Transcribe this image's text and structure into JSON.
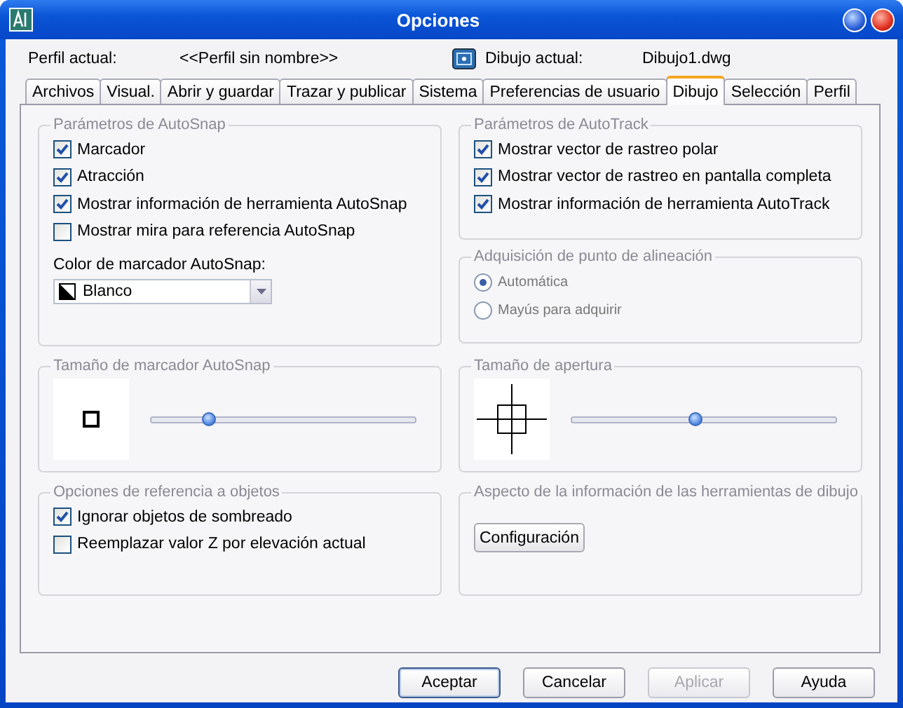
{
  "window": {
    "title": "Opciones"
  },
  "profile": {
    "label": "Perfil actual:",
    "value": "<<Perfil sin nombre>>"
  },
  "drawing": {
    "label": "Dibujo actual:",
    "value": "Dibujo1.dwg"
  },
  "tabs": [
    {
      "label": "Archivos",
      "selected": false
    },
    {
      "label": "Visual.",
      "selected": false
    },
    {
      "label": "Abrir y guardar",
      "selected": false
    },
    {
      "label": "Trazar y publicar",
      "selected": false
    },
    {
      "label": "Sistema",
      "selected": false
    },
    {
      "label": "Preferencias de usuario",
      "selected": false
    },
    {
      "label": "Dibujo",
      "selected": true
    },
    {
      "label": "Selección",
      "selected": false
    },
    {
      "label": "Perfil",
      "selected": false
    }
  ],
  "autosnap": {
    "title": "Parámetros de AutoSnap",
    "options": [
      {
        "label": "Marcador",
        "checked": true
      },
      {
        "label": "Atracción",
        "checked": true
      },
      {
        "label": "Mostrar información de herramienta AutoSnap",
        "checked": true
      },
      {
        "label": "Mostrar mira para referencia AutoSnap",
        "checked": false
      }
    ],
    "color_label": "Color de marcador AutoSnap:",
    "color_value": "Blanco"
  },
  "autotrack": {
    "title": "Parámetros de AutoTrack",
    "options": [
      {
        "label": "Mostrar vector de rastreo polar",
        "checked": true
      },
      {
        "label": "Mostrar vector de rastreo en pantalla completa",
        "checked": true
      },
      {
        "label": "Mostrar información de herramienta AutoTrack",
        "checked": true
      }
    ]
  },
  "alignment": {
    "title": "Adquisición de punto de alineación",
    "disabled": true,
    "options": [
      {
        "label": "Automática",
        "selected": true
      },
      {
        "label": "Mayús para adquirir",
        "selected": false
      }
    ]
  },
  "marker_size": {
    "title": "Tamaño de marcador AutoSnap",
    "level": 0.22
  },
  "aperture_size": {
    "title": "Tamaño de apertura",
    "level": 0.47
  },
  "osnap_options": {
    "title": "Opciones de referencia a objetos",
    "options": [
      {
        "label": "Ignorar objetos de sombreado",
        "checked": true
      },
      {
        "label": "Reemplazar valor Z por elevación actual",
        "checked": false
      }
    ]
  },
  "tooltip_appearance": {
    "title": "Aspecto de la información de las herramientas de dibujo",
    "button": "Configuración"
  },
  "buttons": [
    {
      "label": "Aceptar",
      "disabled": false,
      "default": true
    },
    {
      "label": "Cancelar",
      "disabled": false,
      "default": false
    },
    {
      "label": "Aplicar",
      "disabled": true,
      "default": false
    },
    {
      "label": "Ayuda",
      "disabled": false,
      "default": false
    }
  ]
}
